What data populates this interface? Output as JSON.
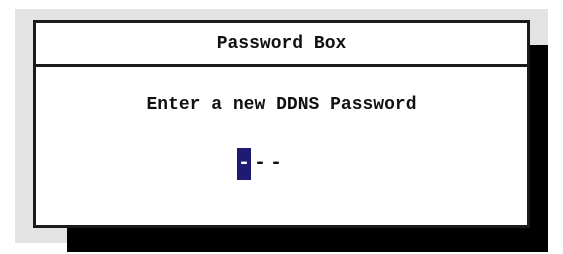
{
  "dialog": {
    "title": "Password Box",
    "prompt": "Enter a new DDNS Password",
    "password_field": {
      "slots": [
        "-",
        "-",
        "-"
      ],
      "active_index": 0
    }
  },
  "colors": {
    "background": "#ffffff",
    "panel": "#e3e3e3",
    "shadow": "#000000",
    "border": "#1a1a1a",
    "cursor_highlight": "#1d1b72"
  }
}
